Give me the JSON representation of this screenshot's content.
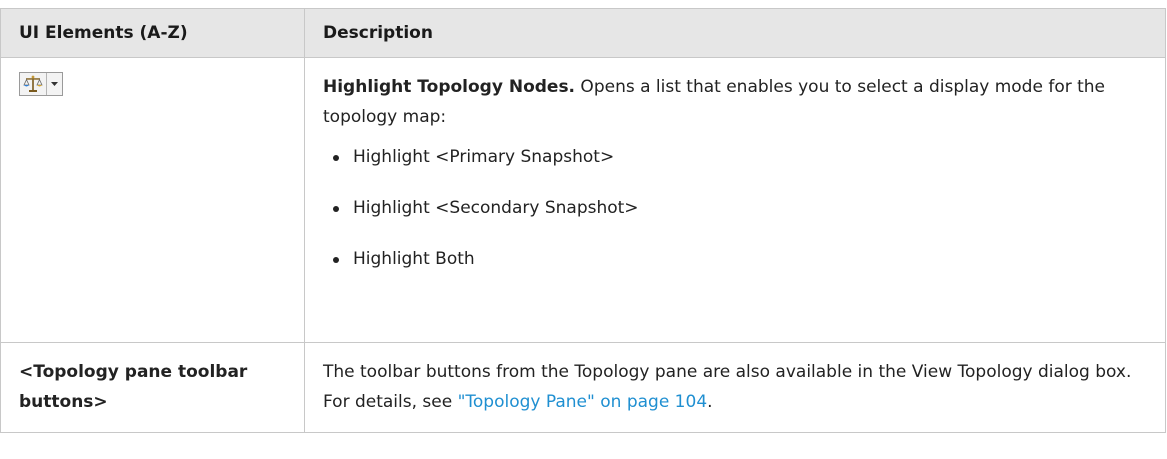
{
  "table": {
    "header": {
      "col1": "UI Elements (A-Z)",
      "col2": "Description"
    },
    "row1": {
      "icon": "highlight-topology-nodes-icon",
      "title": "Highlight Topology Nodes.",
      "text": " Opens a list that enables you to select a display mode for the topology map:",
      "options": [
        "Highlight <Primary Snapshot>",
        "Highlight <Secondary Snapshot>",
        "Highlight Both"
      ]
    },
    "row2": {
      "label": "<Topology pane toolbar buttons>",
      "text_before": "The toolbar buttons from the Topology pane are also available in the View Topology dialog box. For details, see ",
      "link": "\"Topology Pane\" on page 104",
      "text_after": "."
    }
  },
  "colors": {
    "header_bg": "#e6e6e6",
    "border": "#c8c8c8",
    "link": "#1f8fd1"
  }
}
